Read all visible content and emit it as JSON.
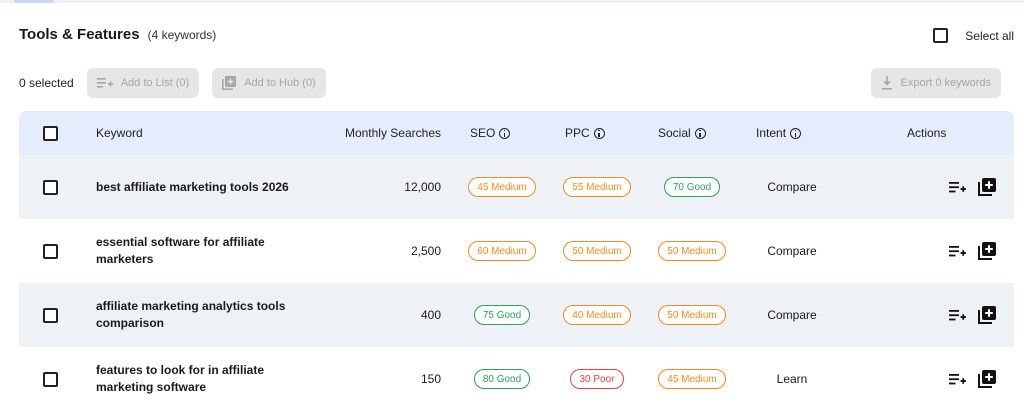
{
  "header": {
    "title": "Tools & Features",
    "count": "(4 keywords)",
    "select_all_label": "Select all"
  },
  "toolbar": {
    "selected_text": "0 selected",
    "add_to_list_label": "Add to List (0)",
    "add_to_hub_label": "Add to Hub (0)",
    "export_label": "Export 0 keywords"
  },
  "table": {
    "columns": {
      "keyword": "Keyword",
      "monthly_searches": "Monthly Searches",
      "seo": "SEO",
      "ppc": "PPC",
      "social": "Social",
      "intent": "Intent",
      "actions": "Actions"
    },
    "rows": [
      {
        "keyword": "best affiliate marketing tools 2026",
        "searches": "12,000",
        "seo": "45 Medium",
        "seo_level": "medium",
        "ppc": "55 Medium",
        "ppc_level": "medium",
        "social": "70 Good",
        "social_level": "good",
        "intent": "Compare"
      },
      {
        "keyword": "essential software for affiliate marketers",
        "searches": "2,500",
        "seo": "60 Medium",
        "seo_level": "medium",
        "ppc": "50 Medium",
        "ppc_level": "medium",
        "social": "50 Medium",
        "social_level": "medium",
        "intent": "Compare"
      },
      {
        "keyword": "affiliate marketing analytics tools comparison",
        "searches": "400",
        "seo": "75 Good",
        "seo_level": "good",
        "ppc": "40 Medium",
        "ppc_level": "medium",
        "social": "50 Medium",
        "social_level": "medium",
        "intent": "Compare"
      },
      {
        "keyword": "features to look for in affiliate marketing software",
        "searches": "150",
        "seo": "80 Good",
        "seo_level": "good",
        "ppc": "30 Poor",
        "ppc_level": "poor",
        "social": "45 Medium",
        "social_level": "medium",
        "intent": "Learn"
      }
    ]
  },
  "colors": {
    "header_bg": "#e5ecfb",
    "alt_row_bg": "#eef1f5",
    "medium": "#f08c28",
    "good": "#2f9e5e",
    "poor": "#e0453f",
    "disabled_button_bg": "#e6e6e6"
  },
  "icons": {
    "add_to_list": "playlist-add-icon",
    "add_to_hub": "library-add-icon",
    "export": "download-icon",
    "info": "info-icon"
  }
}
